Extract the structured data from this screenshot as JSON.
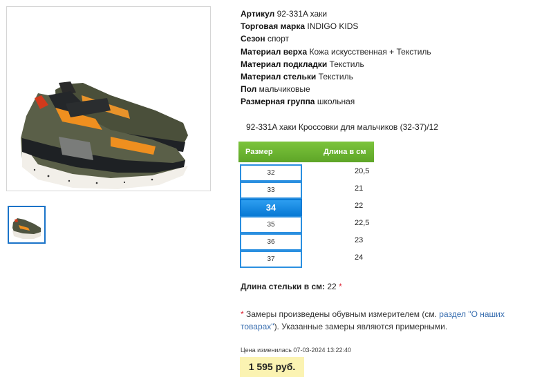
{
  "gallery": {
    "main_image_icon": "sneaker-photo",
    "thumbnail_icon": "sneaker-thumbnail"
  },
  "specs": [
    {
      "label": "Артикул",
      "value": "92-331A хаки"
    },
    {
      "label": "Торговая марка",
      "value": "INDIGO KIDS"
    },
    {
      "label": "Сезон",
      "value": "спорт"
    },
    {
      "label": "Материал верха",
      "value": "Кожа искусственная + Текстиль"
    },
    {
      "label": "Материал подкладки",
      "value": "Текстиль"
    },
    {
      "label": "Материал стельки",
      "value": "Текстиль"
    },
    {
      "label": "Пол",
      "value": "мальчиковые"
    },
    {
      "label": "Размерная группа",
      "value": "школьная"
    }
  ],
  "product_title": "92-331A хаки Кроссовки для мальчиков (32-37)/12",
  "size_table": {
    "header_size": "Размер",
    "header_length": "Длина в см",
    "rows": [
      {
        "size": "32",
        "length": "20,5"
      },
      {
        "size": "33",
        "length": "21"
      },
      {
        "size": "34",
        "length": "22"
      },
      {
        "size": "35",
        "length": "22,5"
      },
      {
        "size": "36",
        "length": "23"
      },
      {
        "size": "37",
        "length": "24"
      }
    ],
    "selected": "34"
  },
  "insole": {
    "label": "Длина стельки в см:",
    "value": "22",
    "asterisk": "*"
  },
  "note": {
    "asterisk": "*",
    "text_before": " Замеры произведены обувным измерителем (см. ",
    "link": "раздел \"О наших товарах\"",
    "text_after": "). Указанные замеры являются примерными."
  },
  "price_changed": "Цена изменилась 07-03-2024 13:22:40",
  "price": "1 595 руб.",
  "colors": {
    "accent_blue": "#1a73c8",
    "header_green": "#6cb430",
    "price_bg": "#fbf3b2",
    "asterisk_red": "#dd2233"
  }
}
